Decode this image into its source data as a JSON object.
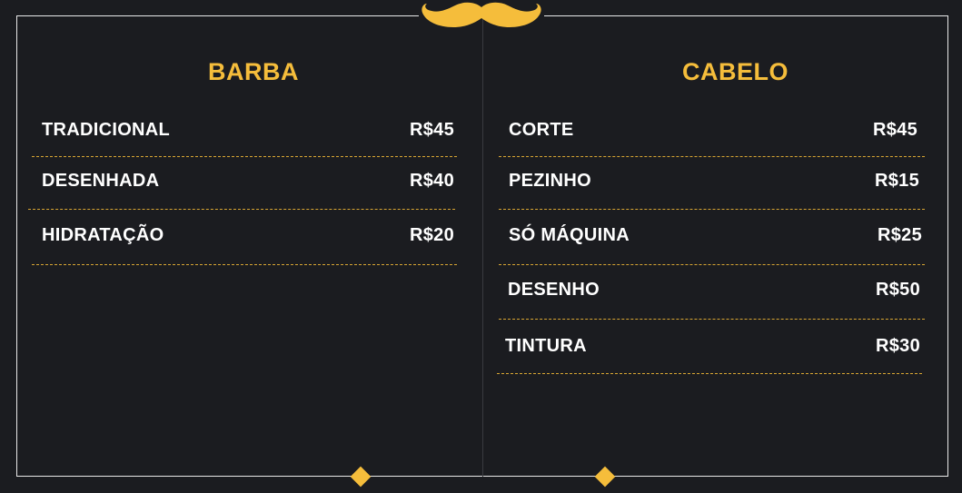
{
  "colors": {
    "accent": "#f5bd3b",
    "background": "#1b1c20",
    "text": "#ffffff",
    "frame": "#e9e9e9"
  },
  "decor": {
    "top_icon": "mustache-icon",
    "bottom_icon": "diamond-icon"
  },
  "barba": {
    "title": "BARBA",
    "items": [
      {
        "name": "TRADICIONAL",
        "price": "R$45"
      },
      {
        "name": "DESENHADA",
        "price": "R$40"
      },
      {
        "name": "HIDRATAÇÃO",
        "price": "R$20"
      }
    ]
  },
  "cabelo": {
    "title": "CABELO",
    "items": [
      {
        "name": "CORTE",
        "price": "R$45"
      },
      {
        "name": "PEZINHO",
        "price": "R$15"
      },
      {
        "name": "SÓ MÁQUINA",
        "price": "R$25"
      },
      {
        "name": "DESENHO",
        "price": "R$50"
      },
      {
        "name": "TINTURA",
        "price": "R$30"
      }
    ]
  }
}
